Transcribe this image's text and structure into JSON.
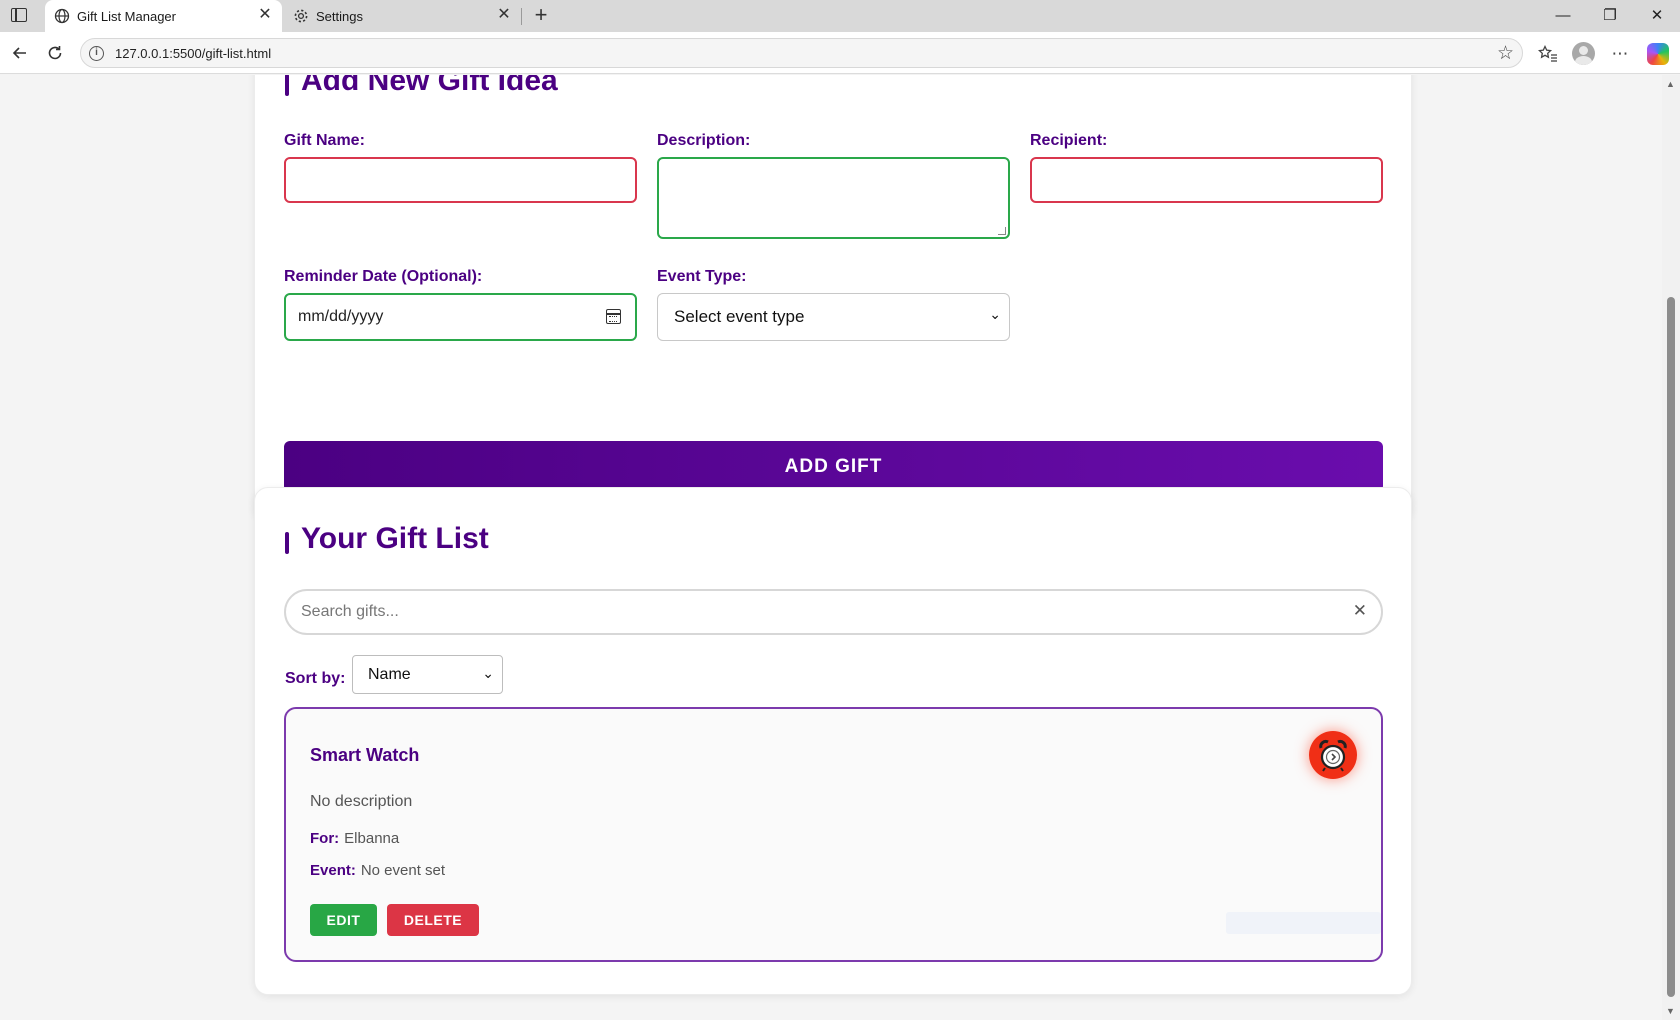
{
  "browser": {
    "tabs": [
      {
        "title": "Gift List Manager",
        "close": "✕"
      },
      {
        "title": "Settings",
        "close": "✕"
      }
    ],
    "new_tab": "+",
    "url": "127.0.0.1:5500/gift-list.html",
    "window_controls": {
      "minimize": "—",
      "restore": "❐",
      "close": "✕"
    }
  },
  "form": {
    "title": "Add New Gift Idea",
    "gift_name_label": "Gift Name:",
    "description_label": "Description:",
    "recipient_label": "Recipient:",
    "reminder_label": "Reminder Date (Optional):",
    "reminder_placeholder": "mm/dd/yyyy",
    "event_type_label": "Event Type:",
    "event_type_selected": "Select event type",
    "add_button": "ADD GIFT"
  },
  "list": {
    "title": "Your Gift List",
    "search_placeholder": "Search gifts...",
    "search_clear": "✕",
    "sort_label": "Sort by:",
    "sort_selected": "Name",
    "items": [
      {
        "name": "Smart Watch",
        "description": "No description",
        "for_label": "For:",
        "for_value": "Elbanna",
        "event_label": "Event:",
        "event_value": "No event set",
        "edit_label": "EDIT",
        "delete_label": "DELETE",
        "reminder_icon": "alarm-clock-icon"
      }
    ]
  },
  "colors": {
    "accent": "#4b0082",
    "button_gradient_end": "#6a0dad",
    "invalid_border": "#d9364d",
    "valid_border": "#2aa84a",
    "edit_button": "#28a745",
    "delete_button": "#dc3545",
    "reminder_button": "#f02f16"
  }
}
